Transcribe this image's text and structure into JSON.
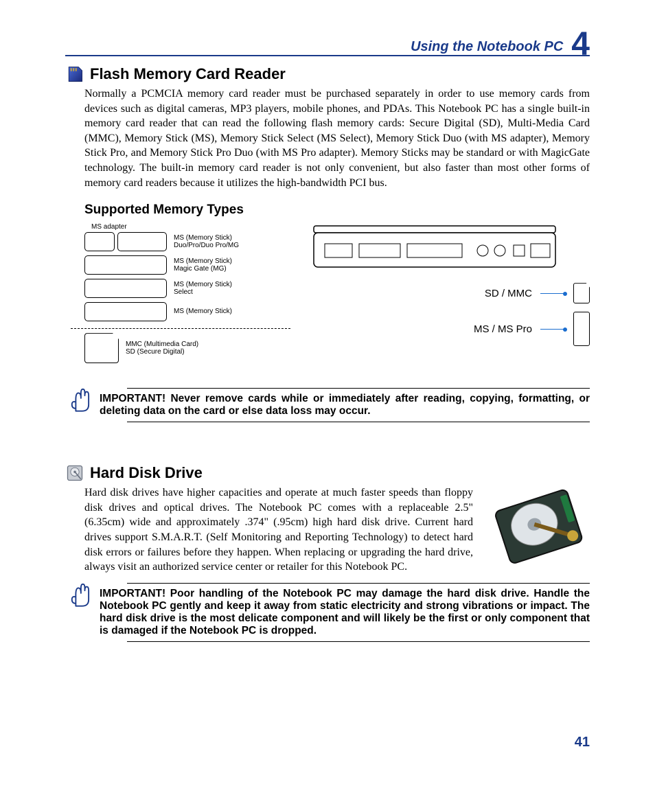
{
  "header": {
    "title": "Using the Notebook PC",
    "chapter": "4"
  },
  "page_number": "41",
  "section1": {
    "title": "Flash Memory Card Reader",
    "body": "Normally a PCMCIA memory card reader must be purchased separately in order to use memory cards from devices such as digital cameras, MP3 players, mobile phones, and PDAs. This Notebook PC has a single built-in memory card reader that can read the following flash memory cards: Secure Digital (SD), Multi-Media Card (MMC), Memory Stick (MS), Memory Stick Select (MS Select), Memory Stick Duo (with MS adapter), Memory Stick Pro, and Memory Stick Pro Duo (with MS Pro adapter). Memory Sticks may be standard or with MagicGate technology. The built-in memory card reader is not only convenient, but also faster than most other forms of memory card readers because it utilizes the high-bandwidth PCI bus.",
    "subheading": "Supported Memory Types",
    "adapter_label": "MS adapter",
    "cards": {
      "r1": "MS (Memory Stick)\nDuo/Pro/Duo Pro/MG",
      "r2": "MS (Memory Stick)\nMagic Gate (MG)",
      "r3": "MS (Memory Stick)\nSelect",
      "r4": "MS (Memory Stick)",
      "r5": "MMC (Multimedia Card)\nSD (Secure Digital)"
    },
    "slots": {
      "sd": "SD / MMC",
      "ms": "MS / MS Pro"
    },
    "important": "IMPORTANT!  Never remove cards while or immediately after reading, copying, formatting, or deleting data on the card or else data loss may occur."
  },
  "section2": {
    "title": "Hard Disk Drive",
    "body": "Hard disk drives have higher capacities and operate at much faster speeds than floppy disk drives and optical drives. The Notebook PC comes with a replaceable 2.5\" (6.35cm) wide and approximately .374\" (.95cm) high hard disk drive. Current hard drives support S.M.A.R.T. (Self Monitoring and Reporting Technology) to detect hard disk errors or failures before they happen. When replacing or upgrading the hard drive, always visit an authorized service center or retailer for this Notebook PC.",
    "important": "IMPORTANT!  Poor handling of the Notebook PC may damage the hard disk drive. Handle the Notebook PC gently and keep it away from static electricity and strong vibrations or impact. The hard disk drive is the most delicate component and will likely be the first or only component that is damaged if the Notebook PC is dropped."
  }
}
